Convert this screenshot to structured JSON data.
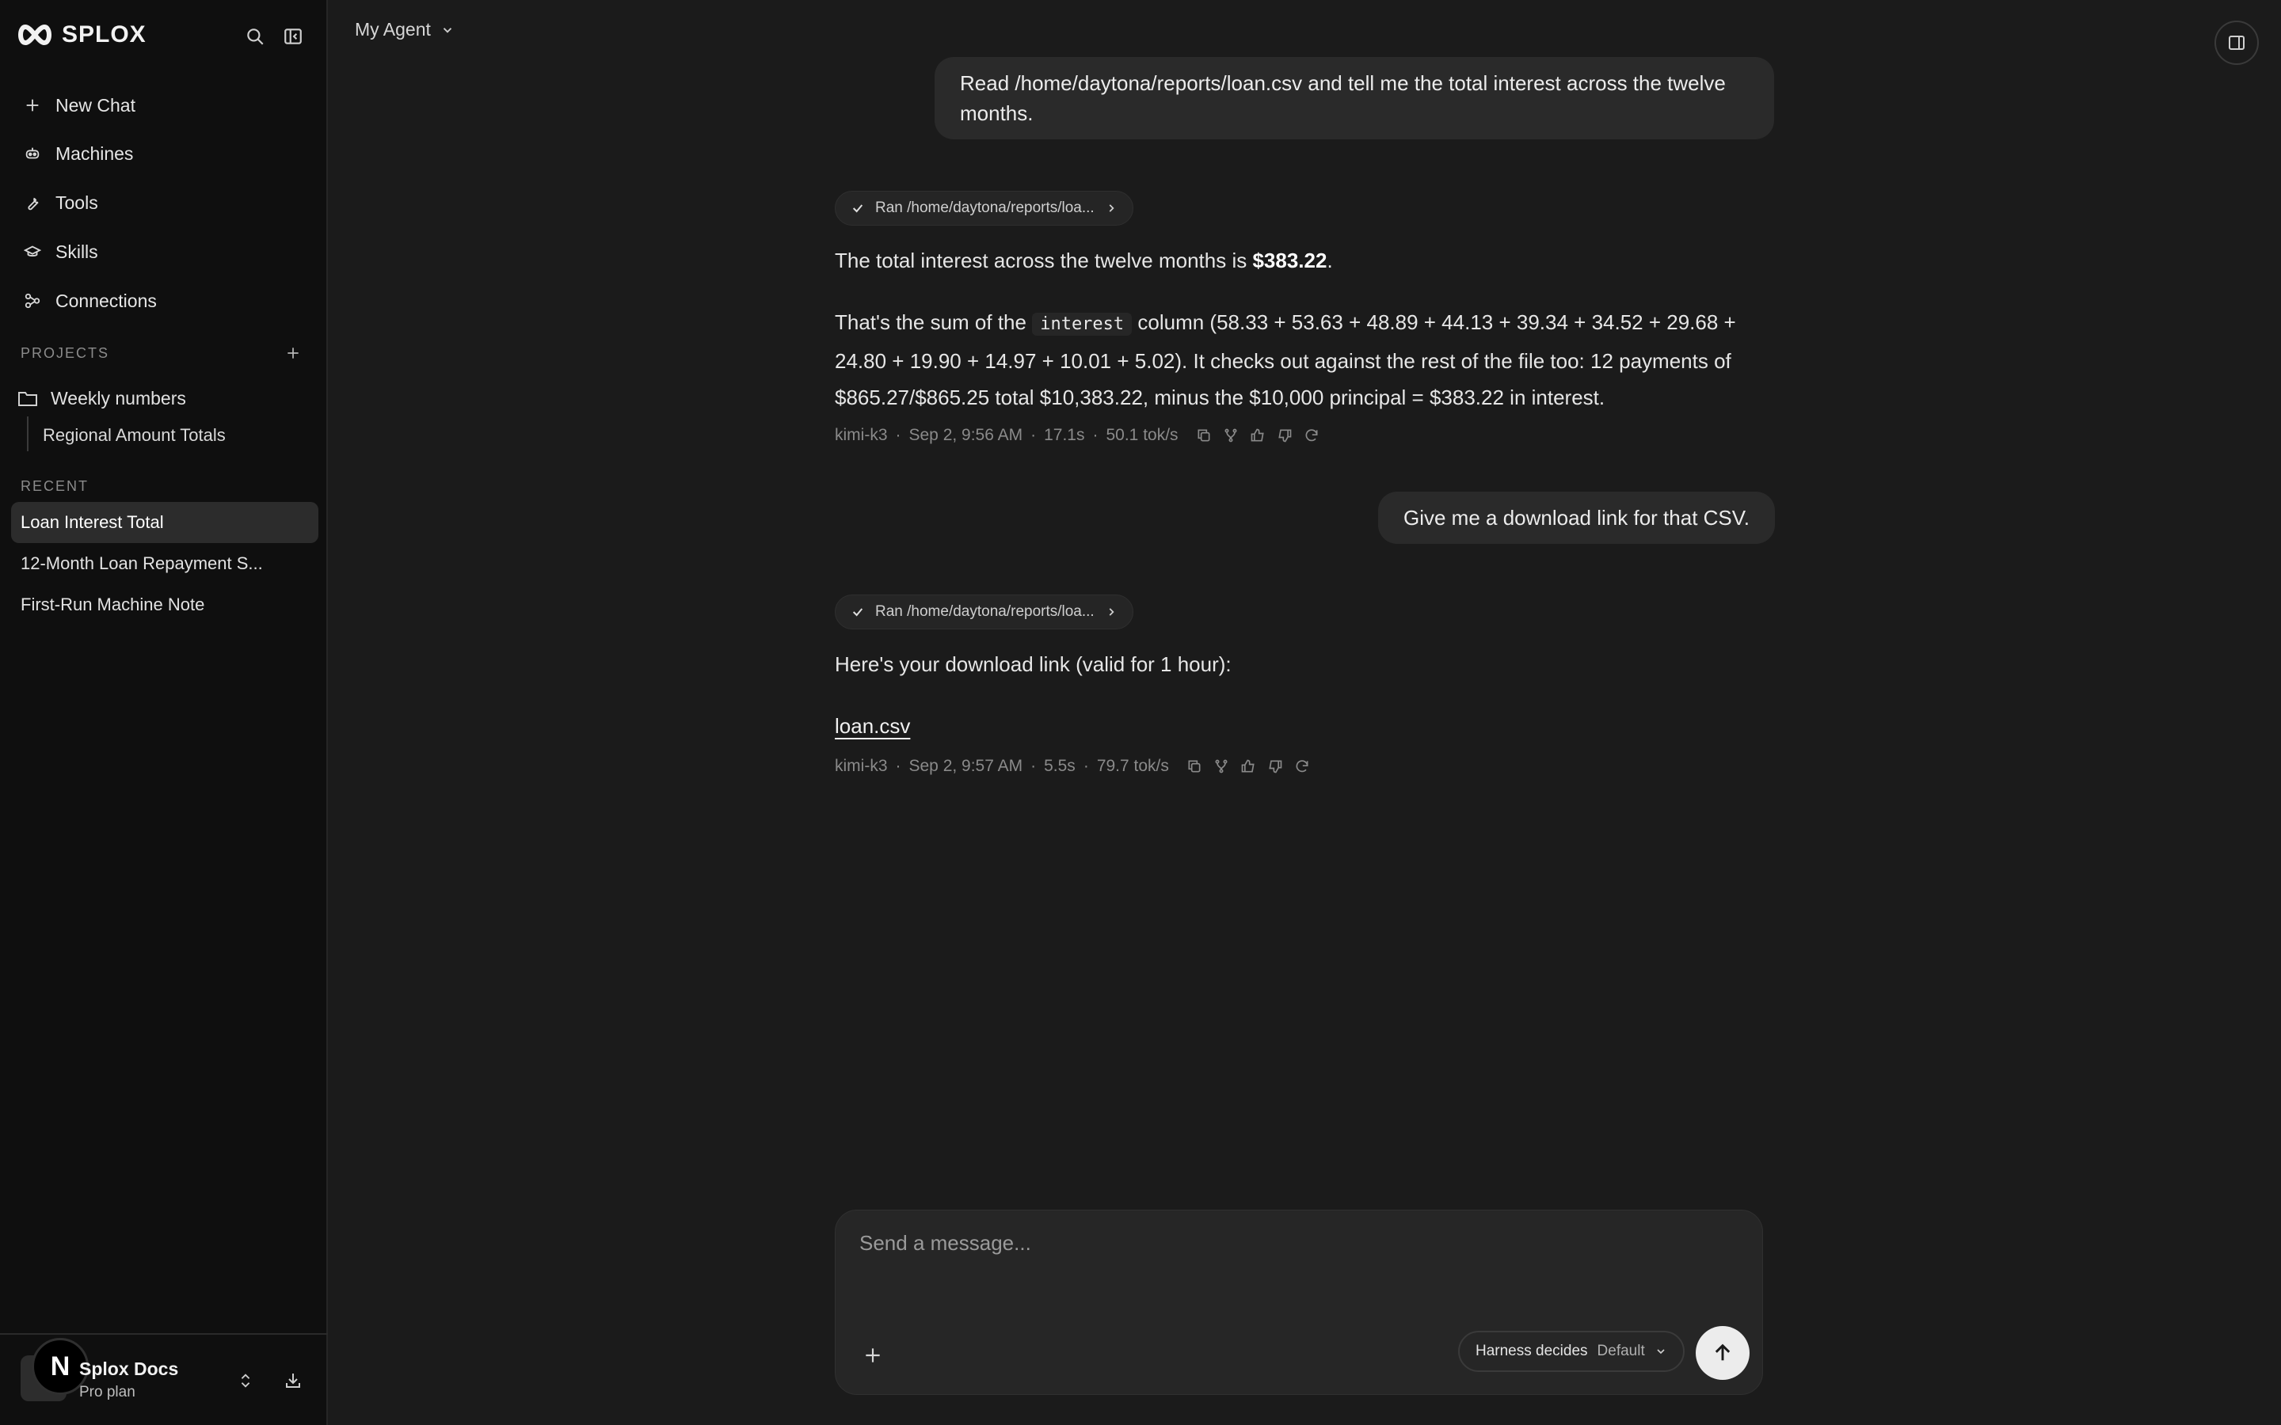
{
  "app": {
    "brand": "SPLOX"
  },
  "sidebar": {
    "nav": [
      {
        "label": "New Chat",
        "icon": "plus-icon"
      },
      {
        "label": "Machines",
        "icon": "robot-icon"
      },
      {
        "label": "Tools",
        "icon": "wrench-icon"
      },
      {
        "label": "Skills",
        "icon": "graduation-cap-icon"
      },
      {
        "label": "Connections",
        "icon": "connections-icon"
      }
    ],
    "projects_label": "PROJECTS",
    "projects": [
      {
        "label": "Weekly numbers",
        "children": [
          "Regional Amount Totals"
        ]
      }
    ],
    "recent_label": "RECENT",
    "recent": [
      {
        "label": "Loan Interest Total",
        "active": true
      },
      {
        "label": "12-Month Loan Repayment S...",
        "active": false
      },
      {
        "label": "First-Run Machine Note",
        "active": false
      }
    ],
    "account": {
      "avatar_letter": "N",
      "name": "Splox Docs",
      "plan": "Pro plan"
    }
  },
  "header": {
    "agent_name": "My Agent"
  },
  "conversation": {
    "turn1": {
      "user": "Read /home/daytona/reports/loan.csv and tell me the total interest across the twelve months.",
      "tool_chip": "Ran /home/daytona/reports/loa...",
      "answer_lead": "The total interest across the twelve months is ",
      "answer_value": "$383.22",
      "answer_end": ".",
      "detail_pre": "That's the sum of the ",
      "detail_code": "interest",
      "detail_post": " column (58.33 + 53.63 + 48.89 + 44.13 + 39.34 + 34.52 + 29.68 + 24.80 + 19.90 + 14.97 + 10.01 + 5.02). It checks out against the rest of the file too: 12 payments of $865.27/$865.25 total $10,383.22, minus the $10,000 principal = $383.22 in interest.",
      "meta": {
        "model": "kimi-k3",
        "time": "Sep 2, 9:56 AM",
        "duration": "17.1s",
        "speed": "50.1 tok/s"
      }
    },
    "turn2": {
      "user": "Give me a download link for that CSV.",
      "tool_chip": "Ran /home/daytona/reports/loa...",
      "answer": "Here's your download link (valid for 1 hour):",
      "link": "loan.csv",
      "meta": {
        "model": "kimi-k3",
        "time": "Sep 2, 9:57 AM",
        "duration": "5.5s",
        "speed": "79.7 tok/s"
      }
    }
  },
  "composer": {
    "placeholder": "Send a message...",
    "harness_label": "Harness decides",
    "harness_value": "Default"
  },
  "colors": {
    "background": "#1b1b1b",
    "sidebar": "#0f0f0f",
    "bubble": "#2a2a2a",
    "accent": "#ececec"
  }
}
